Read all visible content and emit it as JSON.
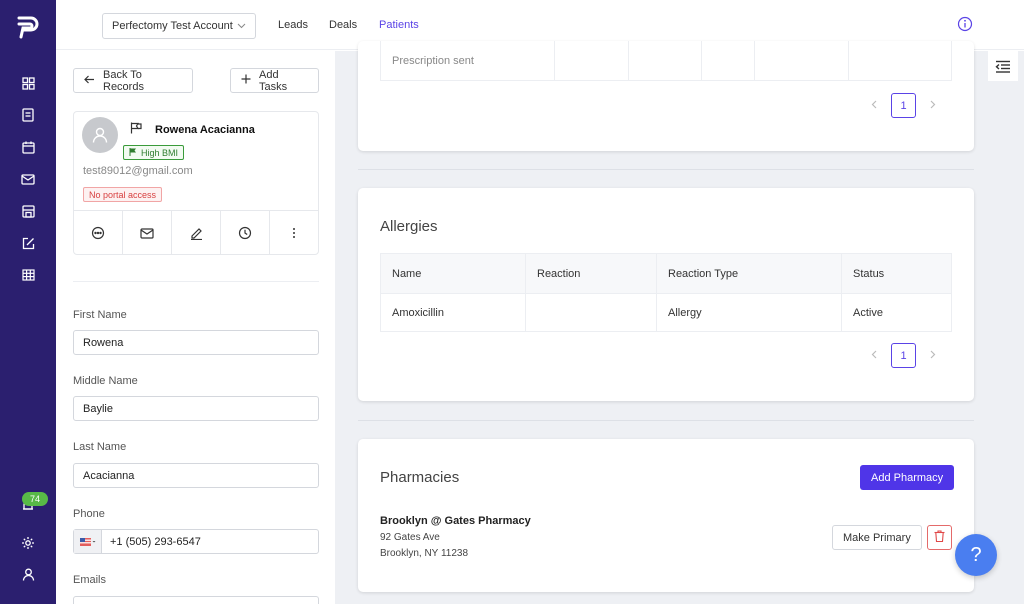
{
  "colors": {
    "sidebar_bg": "#2b1f6f",
    "accent": "#5a43e6",
    "primary_button": "#4f35e8",
    "badge_green": "#58b947",
    "danger": "#e46a6a",
    "help_button": "#4a7ef0"
  },
  "sidebar": {
    "logo": "perfectomy-logo",
    "items": [
      {
        "icon": "grid-icon"
      },
      {
        "icon": "document-icon"
      },
      {
        "icon": "calendar-icon"
      },
      {
        "icon": "mail-icon"
      },
      {
        "icon": "store-icon"
      },
      {
        "icon": "edit-square-icon"
      },
      {
        "icon": "table-icon"
      }
    ],
    "notification_count": "74",
    "bottom_items": [
      {
        "icon": "gear-icon"
      },
      {
        "icon": "user-icon"
      }
    ]
  },
  "topnav": {
    "account": "Perfectomy Test Account",
    "links": [
      "Leads",
      "Deals",
      "Patients"
    ],
    "active_link": "Patients"
  },
  "left": {
    "back_label": "Back To Records",
    "add_tasks_label": "Add Tasks",
    "patient": {
      "name": "Rowena Acacianna",
      "tag": "High BMI",
      "email": "test89012@gmail.com",
      "portal_status": "No portal access"
    },
    "fields": {
      "first_name_label": "First Name",
      "first_name": "Rowena",
      "middle_name_label": "Middle Name",
      "middle_name": "Baylie",
      "last_name_label": "Last Name",
      "last_name": "Acacianna",
      "phone_label": "Phone",
      "phone": "+1 (505) 293-6547",
      "emails_label": "Emails"
    }
  },
  "prescriptions": {
    "row_text": "Prescription sent",
    "current_page": "1"
  },
  "allergies": {
    "title": "Allergies",
    "columns": [
      "Name",
      "Reaction",
      "Reaction Type",
      "Status"
    ],
    "rows": [
      [
        "Amoxicillin",
        "",
        "Allergy",
        "Active"
      ]
    ],
    "current_page": "1"
  },
  "pharmacies": {
    "title": "Pharmacies",
    "add_label": "Add Pharmacy",
    "items": [
      {
        "name": "Brooklyn @ Gates Pharmacy",
        "address1": "92 Gates Ave",
        "address2": "Brooklyn, NY 11238",
        "make_primary_label": "Make Primary"
      }
    ]
  },
  "help": {
    "label": "?"
  }
}
